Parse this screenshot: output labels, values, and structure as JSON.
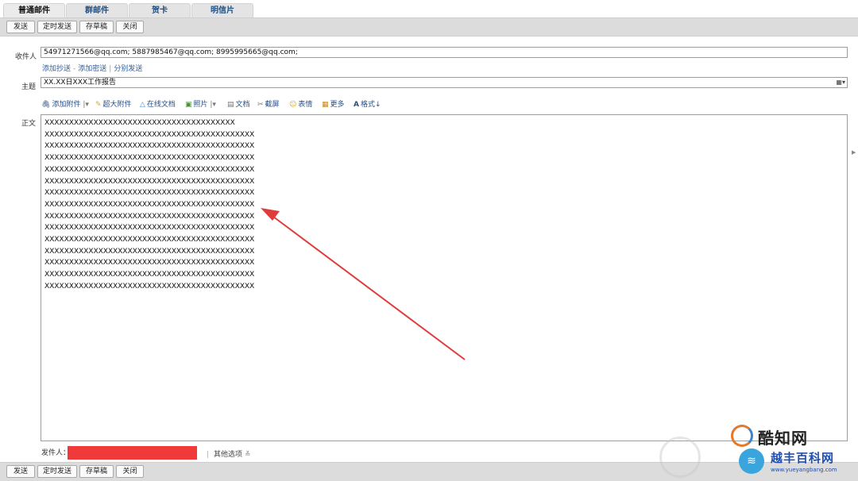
{
  "tabs": [
    {
      "label": "普通邮件",
      "active": true
    },
    {
      "label": "群邮件",
      "active": false
    },
    {
      "label": "贺卡",
      "active": false
    },
    {
      "label": "明信片",
      "active": false
    }
  ],
  "toolbar": {
    "send": "发送",
    "scheduled_send": "定时发送",
    "save_draft": "存草稿",
    "close": "关闭"
  },
  "form": {
    "to_label": "收件人",
    "to_value": "54971271566@qq.com;  5887985467@qq.com;  8995995665@qq.com;",
    "add_cc": "添加抄送",
    "add_bcc": "添加密送",
    "separate_send": "分别发送",
    "subject_label": "主题",
    "subject_value": "XX.XX日XXX工作报告",
    "subject_icon": "grid-icon",
    "body_label": "正文"
  },
  "editor_tools": [
    {
      "icon": "paperclip-icon",
      "glyph": "🖇",
      "label": "添加附件",
      "has_dropdown": true
    },
    {
      "icon": "large-attachment-icon",
      "glyph": "✎",
      "label": "超大附件",
      "has_dropdown": false
    },
    {
      "icon": "online-doc-icon",
      "glyph": "△",
      "label": "在线文档",
      "has_dropdown": false
    },
    {
      "icon": "photo-icon",
      "glyph": "▣",
      "label": "照片",
      "has_dropdown": true
    },
    {
      "icon": "document-icon",
      "glyph": "▤",
      "label": "文档",
      "has_dropdown": false
    },
    {
      "icon": "screenshot-icon",
      "glyph": "✂",
      "label": "截屏",
      "has_dropdown": false
    },
    {
      "icon": "emoji-icon",
      "glyph": "☺",
      "label": "表情",
      "has_dropdown": false
    },
    {
      "icon": "more-icon",
      "glyph": "▦",
      "label": "更多",
      "has_dropdown": false
    },
    {
      "icon": "format-icon",
      "glyph": "A",
      "label": "格式↓",
      "has_dropdown": false
    }
  ],
  "body_lines": [
    "XXXXXXXXXXXXXXXXXXXXXXXXXXXXXXXXXXXXXXX",
    "XXXXXXXXXXXXXXXXXXXXXXXXXXXXXXXXXXXXXXXXXXX",
    "XXXXXXXXXXXXXXXXXXXXXXXXXXXXXXXXXXXXXXXXXXX",
    "XXXXXXXXXXXXXXXXXXXXXXXXXXXXXXXXXXXXXXXXXXX",
    "XXXXXXXXXXXXXXXXXXXXXXXXXXXXXXXXXXXXXXXXXXX",
    "XXXXXXXXXXXXXXXXXXXXXXXXXXXXXXXXXXXXXXXXXXX",
    "XXXXXXXXXXXXXXXXXXXXXXXXXXXXXXXXXXXXXXXXXXX",
    "XXXXXXXXXXXXXXXXXXXXXXXXXXXXXXXXXXXXXXXXXXX",
    "XXXXXXXXXXXXXXXXXXXXXXXXXXXXXXXXXXXXXXXXXXX",
    "XXXXXXXXXXXXXXXXXXXXXXXXXXXXXXXXXXXXXXXXXXX",
    "XXXXXXXXXXXXXXXXXXXXXXXXXXXXXXXXXXXXXXXXXXX",
    "XXXXXXXXXXXXXXXXXXXXXXXXXXXXXXXXXXXXXXXXXXX",
    "XXXXXXXXXXXXXXXXXXXXXXXXXXXXXXXXXXXXXXXXXXX",
    "XXXXXXXXXXXXXXXXXXXXXXXXXXXXXXXXXXXXXXXXXXX",
    "XXXXXXXXXXXXXXXXXXXXXXXXXXXXXXXXXXXXXXXXXXX"
  ],
  "footer": {
    "sender_label": "发件人：",
    "other_options": "其他选项"
  },
  "watermarks": {
    "site1": "酷知网",
    "site2": "越丰百科网",
    "site2_url": "www.yueyangbang.com"
  },
  "colors": {
    "annotation_arrow": "#e03c3c",
    "redaction": "#f03a3a",
    "link": "#2d5d9f"
  }
}
